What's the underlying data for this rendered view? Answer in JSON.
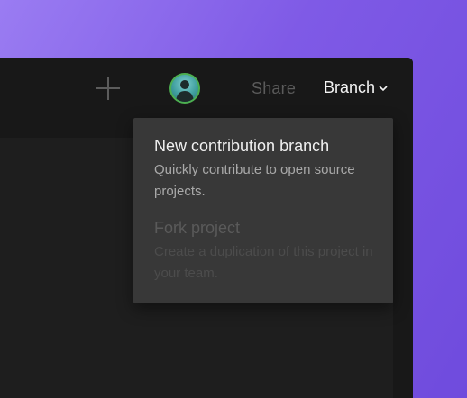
{
  "topbar": {
    "share_label": "Share",
    "branch_label": "Branch",
    "icons": [
      "plus-icon",
      "chevron-down-icon"
    ],
    "avatar_border_color": "#4caf50"
  },
  "content": {
    "fragment_text": "/"
  },
  "branch_menu": {
    "items": [
      {
        "title": "New contribution branch",
        "description": "Quickly contribute to open source projects.",
        "enabled": true
      },
      {
        "title": "Fork project",
        "description": "Create a duplication of this project in your team.",
        "enabled": false
      }
    ]
  },
  "colors": {
    "background_gradient_start": "#9a7cf2",
    "background_gradient_end": "#6f4bdd",
    "app_background": "#1f1f1f",
    "menu_background": "#383838"
  }
}
